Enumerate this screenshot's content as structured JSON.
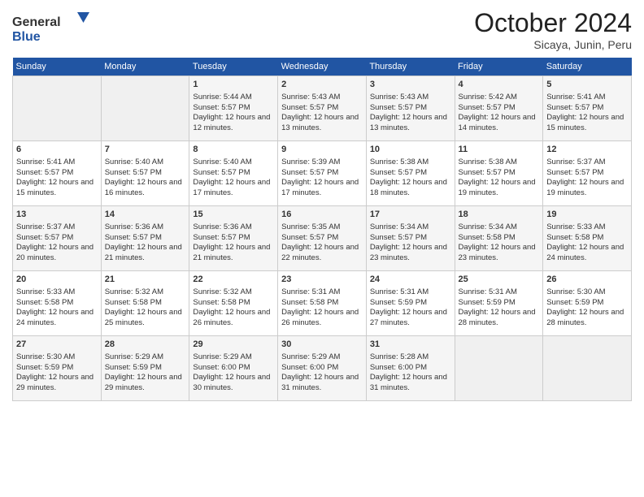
{
  "header": {
    "logo": {
      "general": "General",
      "blue": "Blue"
    },
    "title": "October 2024",
    "subtitle": "Sicaya, Junin, Peru"
  },
  "days_of_week": [
    "Sunday",
    "Monday",
    "Tuesday",
    "Wednesday",
    "Thursday",
    "Friday",
    "Saturday"
  ],
  "weeks": [
    [
      {
        "day": "",
        "empty": true
      },
      {
        "day": "",
        "empty": true
      },
      {
        "day": "1",
        "sunrise": "Sunrise: 5:44 AM",
        "sunset": "Sunset: 5:57 PM",
        "daylight": "Daylight: 12 hours and 12 minutes."
      },
      {
        "day": "2",
        "sunrise": "Sunrise: 5:43 AM",
        "sunset": "Sunset: 5:57 PM",
        "daylight": "Daylight: 12 hours and 13 minutes."
      },
      {
        "day": "3",
        "sunrise": "Sunrise: 5:43 AM",
        "sunset": "Sunset: 5:57 PM",
        "daylight": "Daylight: 12 hours and 13 minutes."
      },
      {
        "day": "4",
        "sunrise": "Sunrise: 5:42 AM",
        "sunset": "Sunset: 5:57 PM",
        "daylight": "Daylight: 12 hours and 14 minutes."
      },
      {
        "day": "5",
        "sunrise": "Sunrise: 5:41 AM",
        "sunset": "Sunset: 5:57 PM",
        "daylight": "Daylight: 12 hours and 15 minutes."
      }
    ],
    [
      {
        "day": "6",
        "sunrise": "Sunrise: 5:41 AM",
        "sunset": "Sunset: 5:57 PM",
        "daylight": "Daylight: 12 hours and 15 minutes."
      },
      {
        "day": "7",
        "sunrise": "Sunrise: 5:40 AM",
        "sunset": "Sunset: 5:57 PM",
        "daylight": "Daylight: 12 hours and 16 minutes."
      },
      {
        "day": "8",
        "sunrise": "Sunrise: 5:40 AM",
        "sunset": "Sunset: 5:57 PM",
        "daylight": "Daylight: 12 hours and 17 minutes."
      },
      {
        "day": "9",
        "sunrise": "Sunrise: 5:39 AM",
        "sunset": "Sunset: 5:57 PM",
        "daylight": "Daylight: 12 hours and 17 minutes."
      },
      {
        "day": "10",
        "sunrise": "Sunrise: 5:38 AM",
        "sunset": "Sunset: 5:57 PM",
        "daylight": "Daylight: 12 hours and 18 minutes."
      },
      {
        "day": "11",
        "sunrise": "Sunrise: 5:38 AM",
        "sunset": "Sunset: 5:57 PM",
        "daylight": "Daylight: 12 hours and 19 minutes."
      },
      {
        "day": "12",
        "sunrise": "Sunrise: 5:37 AM",
        "sunset": "Sunset: 5:57 PM",
        "daylight": "Daylight: 12 hours and 19 minutes."
      }
    ],
    [
      {
        "day": "13",
        "sunrise": "Sunrise: 5:37 AM",
        "sunset": "Sunset: 5:57 PM",
        "daylight": "Daylight: 12 hours and 20 minutes."
      },
      {
        "day": "14",
        "sunrise": "Sunrise: 5:36 AM",
        "sunset": "Sunset: 5:57 PM",
        "daylight": "Daylight: 12 hours and 21 minutes."
      },
      {
        "day": "15",
        "sunrise": "Sunrise: 5:36 AM",
        "sunset": "Sunset: 5:57 PM",
        "daylight": "Daylight: 12 hours and 21 minutes."
      },
      {
        "day": "16",
        "sunrise": "Sunrise: 5:35 AM",
        "sunset": "Sunset: 5:57 PM",
        "daylight": "Daylight: 12 hours and 22 minutes."
      },
      {
        "day": "17",
        "sunrise": "Sunrise: 5:34 AM",
        "sunset": "Sunset: 5:57 PM",
        "daylight": "Daylight: 12 hours and 23 minutes."
      },
      {
        "day": "18",
        "sunrise": "Sunrise: 5:34 AM",
        "sunset": "Sunset: 5:58 PM",
        "daylight": "Daylight: 12 hours and 23 minutes."
      },
      {
        "day": "19",
        "sunrise": "Sunrise: 5:33 AM",
        "sunset": "Sunset: 5:58 PM",
        "daylight": "Daylight: 12 hours and 24 minutes."
      }
    ],
    [
      {
        "day": "20",
        "sunrise": "Sunrise: 5:33 AM",
        "sunset": "Sunset: 5:58 PM",
        "daylight": "Daylight: 12 hours and 24 minutes."
      },
      {
        "day": "21",
        "sunrise": "Sunrise: 5:32 AM",
        "sunset": "Sunset: 5:58 PM",
        "daylight": "Daylight: 12 hours and 25 minutes."
      },
      {
        "day": "22",
        "sunrise": "Sunrise: 5:32 AM",
        "sunset": "Sunset: 5:58 PM",
        "daylight": "Daylight: 12 hours and 26 minutes."
      },
      {
        "day": "23",
        "sunrise": "Sunrise: 5:31 AM",
        "sunset": "Sunset: 5:58 PM",
        "daylight": "Daylight: 12 hours and 26 minutes."
      },
      {
        "day": "24",
        "sunrise": "Sunrise: 5:31 AM",
        "sunset": "Sunset: 5:59 PM",
        "daylight": "Daylight: 12 hours and 27 minutes."
      },
      {
        "day": "25",
        "sunrise": "Sunrise: 5:31 AM",
        "sunset": "Sunset: 5:59 PM",
        "daylight": "Daylight: 12 hours and 28 minutes."
      },
      {
        "day": "26",
        "sunrise": "Sunrise: 5:30 AM",
        "sunset": "Sunset: 5:59 PM",
        "daylight": "Daylight: 12 hours and 28 minutes."
      }
    ],
    [
      {
        "day": "27",
        "sunrise": "Sunrise: 5:30 AM",
        "sunset": "Sunset: 5:59 PM",
        "daylight": "Daylight: 12 hours and 29 minutes."
      },
      {
        "day": "28",
        "sunrise": "Sunrise: 5:29 AM",
        "sunset": "Sunset: 5:59 PM",
        "daylight": "Daylight: 12 hours and 29 minutes."
      },
      {
        "day": "29",
        "sunrise": "Sunrise: 5:29 AM",
        "sunset": "Sunset: 6:00 PM",
        "daylight": "Daylight: 12 hours and 30 minutes."
      },
      {
        "day": "30",
        "sunrise": "Sunrise: 5:29 AM",
        "sunset": "Sunset: 6:00 PM",
        "daylight": "Daylight: 12 hours and 31 minutes."
      },
      {
        "day": "31",
        "sunrise": "Sunrise: 5:28 AM",
        "sunset": "Sunset: 6:00 PM",
        "daylight": "Daylight: 12 hours and 31 minutes."
      },
      {
        "day": "",
        "empty": true
      },
      {
        "day": "",
        "empty": true
      }
    ]
  ]
}
